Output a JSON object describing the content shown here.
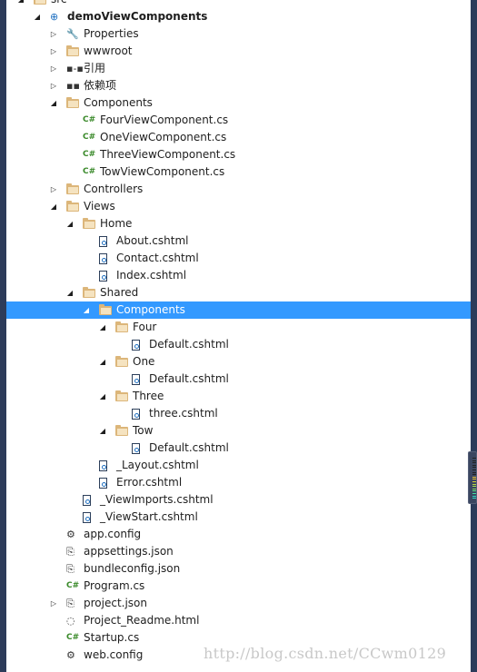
{
  "tree": [
    {
      "label": "src",
      "level": 0,
      "state": "expanded",
      "icon": "folder-icon"
    },
    {
      "label": "demoViewComponents",
      "level": 1,
      "state": "expanded",
      "icon": "web-project-icon",
      "bold": true
    },
    {
      "label": "Properties",
      "level": 2,
      "state": "collapsed",
      "icon": "wrench-icon"
    },
    {
      "label": "wwwroot",
      "level": 2,
      "state": "collapsed",
      "icon": "globe-folder-icon"
    },
    {
      "label": "引用",
      "level": 2,
      "state": "collapsed",
      "icon": "references-icon"
    },
    {
      "label": "依赖项",
      "level": 2,
      "state": "collapsed",
      "icon": "dependencies-icon"
    },
    {
      "label": "Components",
      "level": 2,
      "state": "expanded",
      "icon": "folder-icon"
    },
    {
      "label": "FourViewComponent.cs",
      "level": 3,
      "state": "none",
      "icon": "csharp-file-icon"
    },
    {
      "label": "OneViewComponent.cs",
      "level": 3,
      "state": "none",
      "icon": "csharp-file-icon"
    },
    {
      "label": "ThreeViewComponent.cs",
      "level": 3,
      "state": "none",
      "icon": "csharp-file-icon"
    },
    {
      "label": "TowViewComponent.cs",
      "level": 3,
      "state": "none",
      "icon": "csharp-file-icon"
    },
    {
      "label": "Controllers",
      "level": 2,
      "state": "collapsed",
      "icon": "folder-icon"
    },
    {
      "label": "Views",
      "level": 2,
      "state": "expanded",
      "icon": "folder-icon"
    },
    {
      "label": "Home",
      "level": 3,
      "state": "expanded",
      "icon": "folder-icon"
    },
    {
      "label": "About.cshtml",
      "level": 4,
      "state": "none",
      "icon": "razor-file-icon"
    },
    {
      "label": "Contact.cshtml",
      "level": 4,
      "state": "none",
      "icon": "razor-file-icon"
    },
    {
      "label": "Index.cshtml",
      "level": 4,
      "state": "none",
      "icon": "razor-file-icon"
    },
    {
      "label": "Shared",
      "level": 3,
      "state": "expanded",
      "icon": "folder-icon"
    },
    {
      "label": "Components",
      "level": 4,
      "state": "expanded",
      "icon": "folder-icon",
      "selected": true
    },
    {
      "label": "Four",
      "level": 5,
      "state": "expanded",
      "icon": "folder-icon"
    },
    {
      "label": "Default.cshtml",
      "level": 6,
      "state": "none",
      "icon": "razor-file-icon"
    },
    {
      "label": "One",
      "level": 5,
      "state": "expanded",
      "icon": "folder-icon"
    },
    {
      "label": "Default.cshtml",
      "level": 6,
      "state": "none",
      "icon": "razor-file-icon"
    },
    {
      "label": "Three",
      "level": 5,
      "state": "expanded",
      "icon": "folder-icon"
    },
    {
      "label": "three.cshtml",
      "level": 6,
      "state": "none",
      "icon": "razor-file-icon"
    },
    {
      "label": "Tow",
      "level": 5,
      "state": "expanded",
      "icon": "folder-icon"
    },
    {
      "label": "Default.cshtml",
      "level": 6,
      "state": "none",
      "icon": "razor-file-icon"
    },
    {
      "label": "_Layout.cshtml",
      "level": 4,
      "state": "none",
      "icon": "razor-file-icon"
    },
    {
      "label": "Error.cshtml",
      "level": 4,
      "state": "none",
      "icon": "razor-file-icon"
    },
    {
      "label": "_ViewImports.cshtml",
      "level": 3,
      "state": "none",
      "icon": "razor-file-icon"
    },
    {
      "label": "_ViewStart.cshtml",
      "level": 3,
      "state": "none",
      "icon": "razor-file-icon"
    },
    {
      "label": "app.config",
      "level": 2,
      "state": "none",
      "icon": "config-file-icon"
    },
    {
      "label": "appsettings.json",
      "level": 2,
      "state": "none",
      "icon": "json-file-icon"
    },
    {
      "label": "bundleconfig.json",
      "level": 2,
      "state": "none",
      "icon": "json-file-icon"
    },
    {
      "label": "Program.cs",
      "level": 2,
      "state": "none",
      "icon": "csharp-file-icon"
    },
    {
      "label": "project.json",
      "level": 2,
      "state": "collapsed",
      "icon": "json-file-icon"
    },
    {
      "label": "Project_Readme.html",
      "level": 2,
      "state": "none",
      "icon": "html-file-icon"
    },
    {
      "label": "Startup.cs",
      "level": 2,
      "state": "none",
      "icon": "csharp-file-icon"
    },
    {
      "label": "web.config",
      "level": 2,
      "state": "none",
      "icon": "config-file-icon"
    }
  ],
  "csharp_glyph": "C#",
  "watermark": "http://blog.csdn.net/CCwm0129",
  "colors": {
    "selection": "#3399ff",
    "folder": "#dcb67a",
    "csharp": "#3a8a2a",
    "frame": "#2d3c5a"
  }
}
